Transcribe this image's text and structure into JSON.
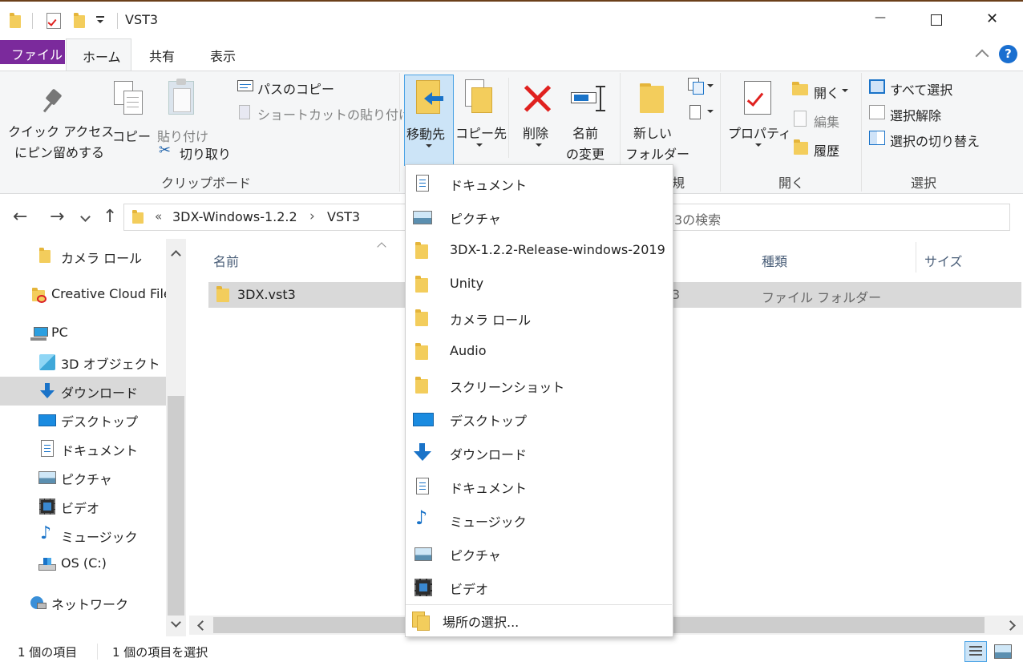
{
  "window": {
    "title": "VST3",
    "minimize_glyph": "—",
    "maximize_glyph": "☐",
    "close_glyph": "✕"
  },
  "ribbon_tabs": [
    {
      "label": "ファイル",
      "active": false,
      "accent": "#7b2a9c"
    },
    {
      "label": "ホーム",
      "active": true
    },
    {
      "label": "共有",
      "active": false
    },
    {
      "label": "表示",
      "active": false
    }
  ],
  "ribbon": {
    "pin_label_1": "クイック アクセス",
    "pin_label_2": "にピン留めする",
    "copy_label": "コピー",
    "paste_label": "貼り付け",
    "copy_path_label": "パスのコピー",
    "paste_shortcut_label": "ショートカットの貼り付け",
    "cut_label": "切り取り",
    "clipboard_group": "クリップボード",
    "move_to_label": "移動先",
    "copy_to_label": "コピー先",
    "delete_label": "削除",
    "rename_label_1": "名前",
    "rename_label_2": "の変更",
    "new_folder_label_1": "新しい",
    "new_folder_label_2": "フォルダー",
    "new_group_partial": "規",
    "properties_label": "プロパティ",
    "open_label": "開く",
    "edit_label": "編集",
    "history_label": "履歴",
    "open_group": "開く",
    "select_all_label": "すべて選択",
    "select_none_label": "選択解除",
    "invert_selection_label": "選択の切り替え",
    "select_group": "選択"
  },
  "address": {
    "overflow": "«",
    "crumbs": [
      "3DX-Windows-1.2.2",
      "VST3"
    ],
    "separator": "›",
    "search_placeholder_partial": "3の検索"
  },
  "sidebar": {
    "items": [
      {
        "label": "カメラ ロール",
        "icon": "folder-icon"
      },
      {
        "label": "Creative Cloud File",
        "icon": "creative-cloud-icon"
      },
      {
        "label": "PC",
        "icon": "pc-icon"
      },
      {
        "label": "3D オブジェクト",
        "icon": "3d-objects-icon"
      },
      {
        "label": "ダウンロード",
        "icon": "download-icon",
        "selected": true
      },
      {
        "label": "デスクトップ",
        "icon": "desktop-icon"
      },
      {
        "label": "ドキュメント",
        "icon": "document-icon"
      },
      {
        "label": "ピクチャ",
        "icon": "picture-icon"
      },
      {
        "label": "ビデオ",
        "icon": "video-icon"
      },
      {
        "label": "ミュージック",
        "icon": "music-icon"
      },
      {
        "label": "OS (C:)",
        "icon": "drive-icon"
      },
      {
        "label": "ネットワーク",
        "icon": "network-icon"
      }
    ]
  },
  "columns": {
    "name": "名前",
    "type": "種類",
    "size": "サイズ"
  },
  "files": [
    {
      "name": "3DX.vst3",
      "date_partial": "3",
      "type": "ファイル フォルダー",
      "selected": true
    }
  ],
  "move_menu": {
    "items": [
      {
        "label": "ドキュメント",
        "icon": "document-icon"
      },
      {
        "label": "ピクチャ",
        "icon": "picture-icon"
      },
      {
        "label": "3DX-1.2.2-Release-windows-2019",
        "icon": "folder-icon"
      },
      {
        "label": "Unity",
        "icon": "folder-icon"
      },
      {
        "label": "カメラ ロール",
        "icon": "folder-icon"
      },
      {
        "label": "Audio",
        "icon": "folder-icon"
      },
      {
        "label": "スクリーンショット",
        "icon": "folder-icon"
      },
      {
        "label": "デスクトップ",
        "icon": "desktop-icon"
      },
      {
        "label": "ダウンロード",
        "icon": "download-icon"
      },
      {
        "label": "ドキュメント",
        "icon": "document-icon"
      },
      {
        "label": "ミュージック",
        "icon": "music-icon"
      },
      {
        "label": "ピクチャ",
        "icon": "picture-icon"
      },
      {
        "label": "ビデオ",
        "icon": "video-icon"
      }
    ],
    "choose_location": "場所の選択..."
  },
  "status": {
    "item_count": "1 個の項目",
    "selected_count": "1 個の項目を選択"
  },
  "colors": {
    "file_tab": "#7b2a9c",
    "accent_blue": "#1a73c8",
    "selection_gray": "#d9d9d9",
    "pressed_button": "#cce4f7",
    "help_blue": "#1a6fd0",
    "delete_red": "#e0211f"
  }
}
